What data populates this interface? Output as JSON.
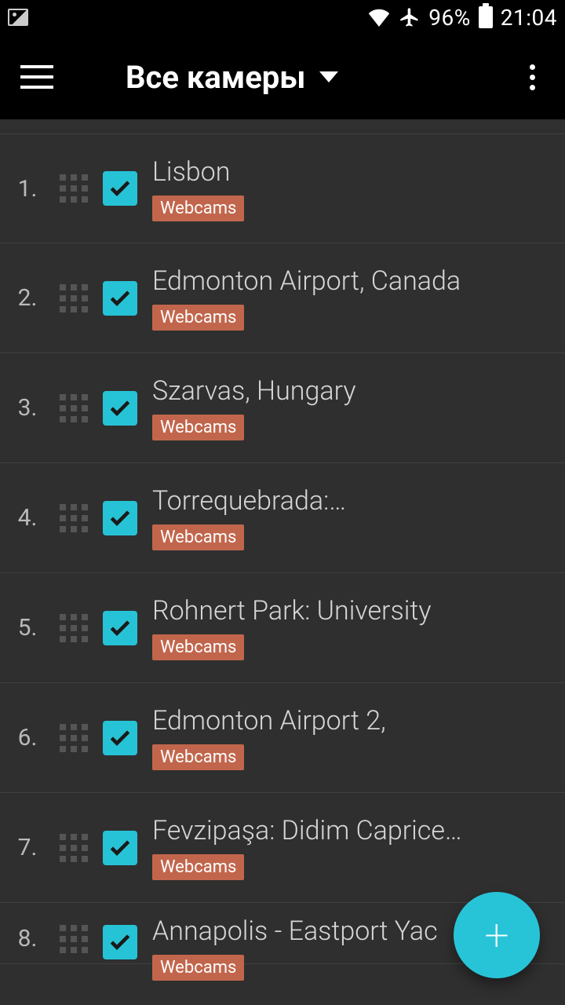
{
  "status": {
    "battery_pct": "96%",
    "time": "21:04"
  },
  "header": {
    "title": "Все камеры"
  },
  "fab": {
    "symbol": "+"
  },
  "items": [
    {
      "num": "1.",
      "title": "Lisbon",
      "tag": "Webcams",
      "checked": true
    },
    {
      "num": "2.",
      "title": "Edmonton Airport, Canada",
      "tag": "Webcams",
      "checked": true
    },
    {
      "num": "3.",
      "title": "Szarvas, Hungary",
      "tag": "Webcams",
      "checked": true
    },
    {
      "num": "4.",
      "title": "Torrequebrada:…",
      "tag": "Webcams",
      "checked": true
    },
    {
      "num": "5.",
      "title": "Rohnert Park: University",
      "tag": "Webcams",
      "checked": true
    },
    {
      "num": "6.",
      "title": "Edmonton Airport 2,",
      "tag": "Webcams",
      "checked": true
    },
    {
      "num": "7.",
      "title": "Fevzipaşa: Didim Caprice…",
      "tag": "Webcams",
      "checked": true
    },
    {
      "num": "8.",
      "title": "Annapolis - Eastport Yac",
      "tag": "Webcams",
      "checked": true
    }
  ]
}
